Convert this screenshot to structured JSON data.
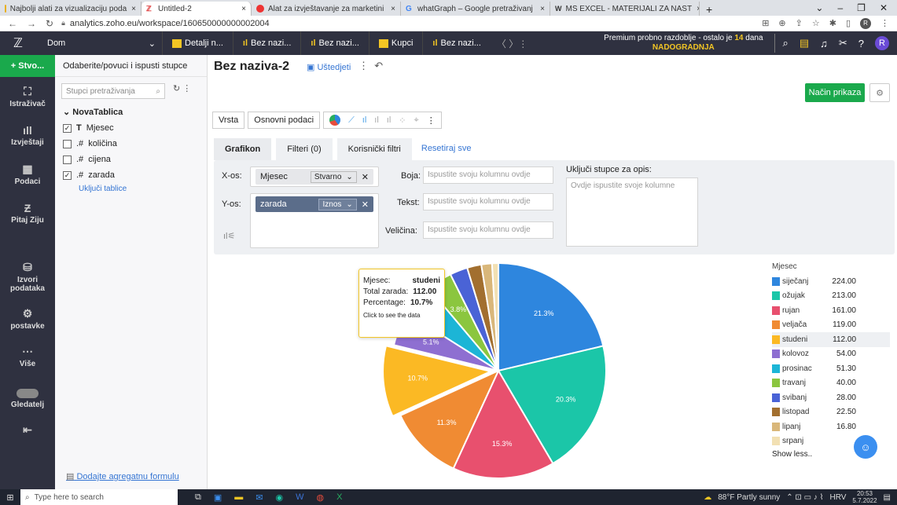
{
  "browser": {
    "tabs": [
      {
        "title": "Najbolji alati za vizualizaciju poda",
        "close": "×"
      },
      {
        "title": "Untitled-2",
        "close": "×"
      },
      {
        "title": "Alat za izvještavanje za marketini",
        "close": "×"
      },
      {
        "title": "whatGraph – Google pretraživanj",
        "close": "×"
      },
      {
        "title": "MS EXCEL - MATERIJALI ZA NAST",
        "close": "×"
      }
    ],
    "newtab": "+",
    "url": "analytics.zoho.eu/workspace/160650000000002004"
  },
  "topnav": {
    "workspace": "Dom",
    "tabs": [
      "Detalji n...",
      "Bez nazi...",
      "Bez nazi...",
      "Kupci",
      "Bez nazi..."
    ],
    "premium_line1": "Premium probno razdoblje - ostalo je",
    "premium_days": "14",
    "premium_days_unit": "dana",
    "upgrade": "NADOGRADNJA",
    "avatar": "R"
  },
  "leftbar": {
    "new": "+ Stvo...",
    "items": [
      "Istraživač",
      "Izvještaji",
      "Podaci",
      "Pitaj Ziju",
      "Izvori podataka",
      "postavke",
      "Više",
      "Gledatelj"
    ]
  },
  "columns": {
    "header": "Odaberite/povuci i ispusti stupce",
    "search_placeholder": "Stupci pretraživanja",
    "table": "NovaTablica",
    "items": [
      {
        "type": "T",
        "name": "Mjesec",
        "checked": "✓"
      },
      {
        "type": ".#",
        "name": "količina",
        "checked": ""
      },
      {
        "type": ".#",
        "name": "cijena",
        "checked": ""
      },
      {
        "type": ".#",
        "name": "zarada",
        "checked": "✓"
      }
    ],
    "include": "Uključi tablice",
    "aggregate": "Dodajte agregatnu formulu"
  },
  "report": {
    "title": "Bez naziva-2",
    "save": "Uštedjeti",
    "view_mode": "Način prikaza",
    "btn_type": "Vrsta",
    "btn_basic": "Osnovni podaci",
    "tabs": {
      "chart": "Grafikon",
      "filters": "Filteri",
      "filters_count": "(0)",
      "user_filters": "Korisnički filtri",
      "reset": "Resetiraj sve"
    },
    "x_label": "X-os:",
    "x_field": "Mjesec",
    "x_agg": "Stvarno",
    "y_label": "Y-os:",
    "y_field": "zarada",
    "y_agg": "Iznos",
    "color_label": "Boja:",
    "text_label": "Tekst:",
    "size_label": "Veličina:",
    "drop_placeholder": "Ispustite svoju kolumnu ovdje",
    "include_label": "Uključi stupce za opis:",
    "include_placeholder": "Ovdje ispustite svoje kolumne"
  },
  "tooltip": {
    "k1": "Mjesec:",
    "v1": "studeni",
    "k2": "Total zarada:",
    "v2": "112.00",
    "k3": "Percentage:",
    "v3": "10.7%",
    "hint": "Click to see the data"
  },
  "chart_data": {
    "type": "pie",
    "legend_title": "Mjesec",
    "categories": [
      "siječanj",
      "ožujak",
      "rujan",
      "veljača",
      "studeni",
      "kolovoz",
      "prosinac",
      "travanj",
      "svibanj",
      "listopad",
      "lipanj",
      "srpanj"
    ],
    "values": [
      224.0,
      213.0,
      161.0,
      119.0,
      112.0,
      54.0,
      51.3,
      40.0,
      28.0,
      22.5,
      16.8,
      10.0
    ],
    "value_labels": [
      "224.00",
      "213.00",
      "161.00",
      "119.00",
      "112.00",
      "54.00",
      "51.30",
      "40.00",
      "28.00",
      "22.50",
      "16.80",
      ""
    ],
    "slice_labels": [
      "21.3%",
      "20.3%",
      "15.3%",
      "11.3%",
      "10.7%",
      "5.1%",
      "",
      "3.8%",
      "",
      "",
      "",
      ""
    ],
    "colors": [
      "#2e86de",
      "#1bc6a8",
      "#e8506e",
      "#f08b33",
      "#fbb924",
      "#8e6fd1",
      "#1cb5d6",
      "#8bc63f",
      "#4a63d6",
      "#a26f2f",
      "#d9b77a",
      "#f2e0b3"
    ],
    "highlight": "studeni",
    "show_less": "Show less.."
  },
  "taskbar": {
    "search": "Type here to search",
    "weather": "88°F Partly sunny",
    "lang": "HRV",
    "time": "20:53",
    "date": "5.7.2022"
  }
}
